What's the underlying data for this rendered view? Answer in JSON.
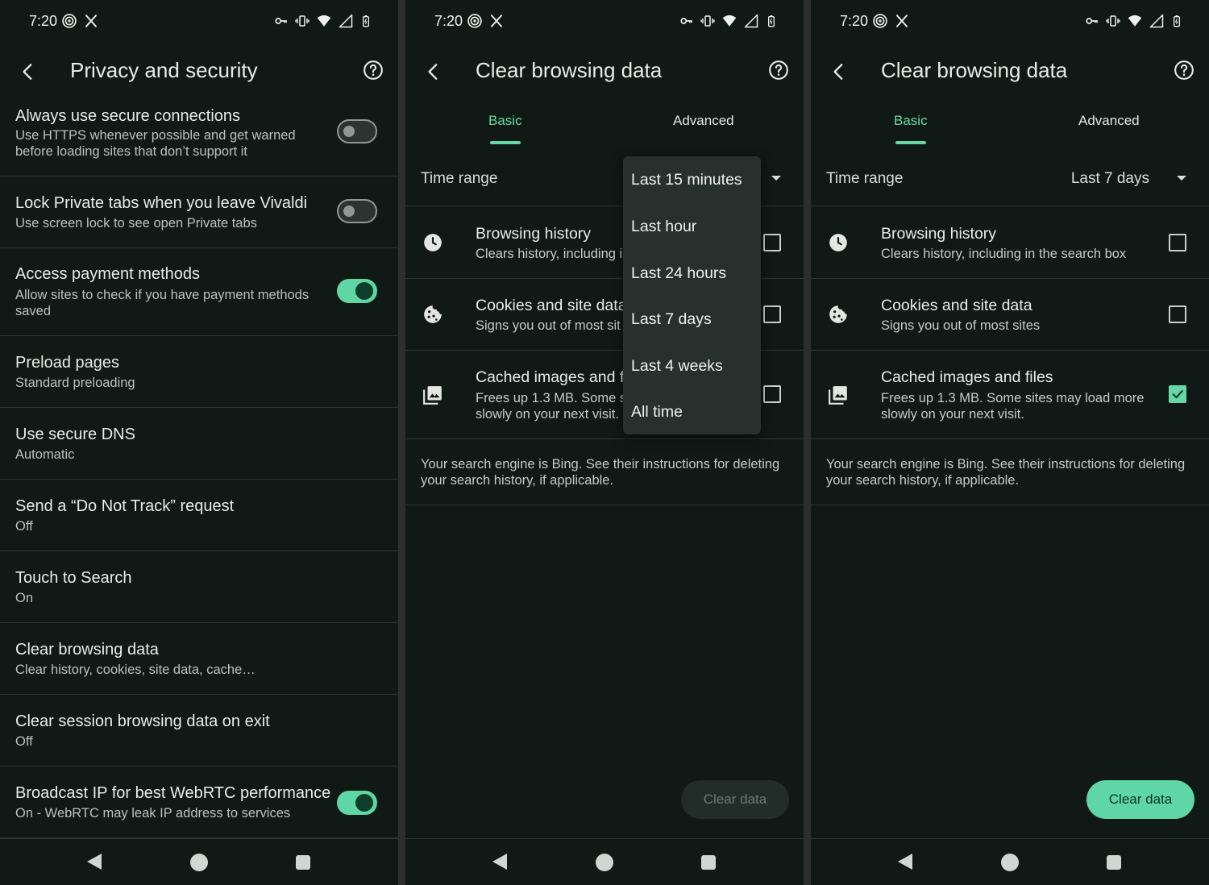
{
  "status_bar": {
    "time": "7:20"
  },
  "screen1": {
    "title": "Privacy and security",
    "rows": [
      {
        "title": "Always use secure connections",
        "subtitle": "Use HTTPS whenever possible and get warned before loading sites that don’t support it",
        "toggle": "off"
      },
      {
        "title": "Lock Private tabs when you leave Vivaldi",
        "subtitle": "Use screen lock to see open Private tabs",
        "toggle": "off"
      },
      {
        "title": "Access payment methods",
        "subtitle": "Allow sites to check if you have payment methods saved",
        "toggle": "on"
      },
      {
        "title": "Preload pages",
        "subtitle": "Standard preloading"
      },
      {
        "title": "Use secure DNS",
        "subtitle": "Automatic"
      },
      {
        "title": "Send a “Do Not Track” request",
        "subtitle": "Off"
      },
      {
        "title": "Touch to Search",
        "subtitle": "On"
      },
      {
        "title": "Clear browsing data",
        "subtitle": "Clear history, cookies, site data, cache…"
      },
      {
        "title": "Clear session browsing data on exit",
        "subtitle": "Off"
      },
      {
        "title": "Broadcast IP for best WebRTC performance",
        "subtitle": "On - WebRTC may leak IP address to services",
        "toggle": "on"
      }
    ]
  },
  "screen2": {
    "title": "Clear browsing data",
    "tabs": [
      "Basic",
      "Advanced"
    ],
    "time_range_label": "Time range",
    "dropdown_options": [
      "Last 15 minutes",
      "Last hour",
      "Last 24 hours",
      "Last 7 days",
      "Last 4 weeks",
      "All time"
    ],
    "items": [
      {
        "title": "Browsing history",
        "subtitle": "Clears history, including i",
        "checked": false
      },
      {
        "title": "Cookies and site data",
        "subtitle": "Signs you out of most sit",
        "checked": false
      },
      {
        "title": "Cached images and fi",
        "subtitle": "Frees up 1.3 MB. Some s slowly on your next visit.",
        "checked": false
      }
    ],
    "engine_note": "Your search engine is Bing. See their instructions for deleting your search history, if applicable.",
    "clear_button": "Clear data"
  },
  "screen3": {
    "title": "Clear browsing data",
    "tabs": [
      "Basic",
      "Advanced"
    ],
    "time_range_label": "Time range",
    "time_range_value": "Last 7 days",
    "items": [
      {
        "title": "Browsing history",
        "subtitle": "Clears history, including in the search box",
        "checked": false
      },
      {
        "title": "Cookies and site data",
        "subtitle": "Signs you out of most sites",
        "checked": false
      },
      {
        "title": "Cached images and files",
        "subtitle": "Frees up 1.3 MB. Some sites may load more slowly on your next visit.",
        "checked": true
      }
    ],
    "engine_note": "Your search engine is Bing. See their instructions for deleting your search history, if applicable.",
    "clear_button": "Clear data"
  },
  "icons": {
    "status_left": [
      "hotspot-icon",
      "x-logo-icon"
    ],
    "status_right": [
      "key-icon",
      "vibrate-icon",
      "wifi-icon",
      "signal-icon",
      "battery-icon"
    ],
    "accent": "#66d8a8"
  }
}
